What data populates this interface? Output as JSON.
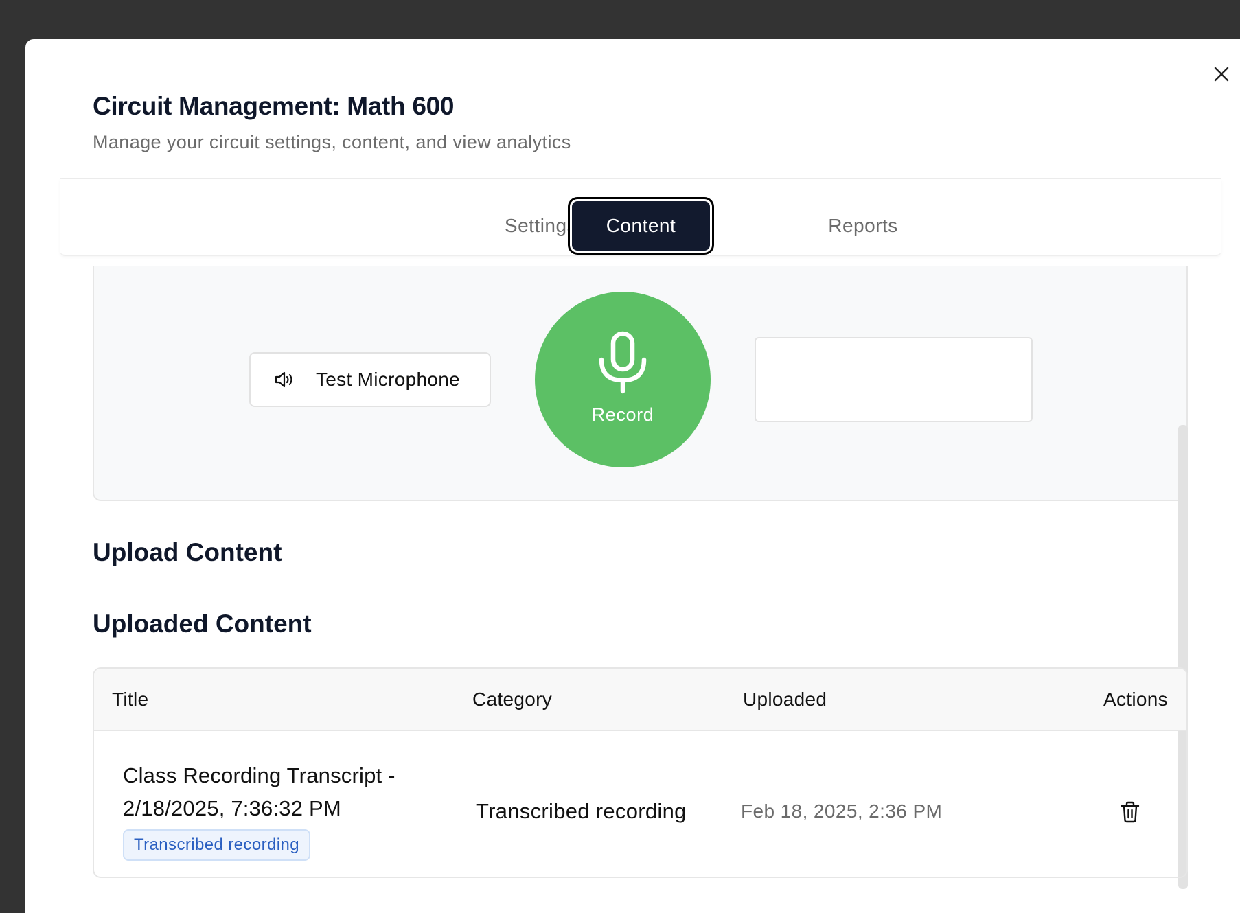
{
  "dialog": {
    "title": "Circuit Management: Math 600",
    "subtitle": "Manage your circuit settings, content, and view analytics",
    "close_icon": "close-icon"
  },
  "tabs": [
    {
      "label": "Settings",
      "active": false
    },
    {
      "label": "Content",
      "active": true
    },
    {
      "label": "Reports",
      "active": false
    }
  ],
  "recorder": {
    "test_microphone_label": "Test Microphone",
    "test_microphone_icon": "speaker-icon",
    "record_label": "Record",
    "record_icon": "microphone-icon",
    "record_color": "#5cc065",
    "status_text": ""
  },
  "upload_section": {
    "heading": "Upload Content"
  },
  "uploaded_section": {
    "heading": "Uploaded Content",
    "columns": [
      "Title",
      "Category",
      "Uploaded",
      "Actions"
    ],
    "rows": [
      {
        "title": "Class Recording Transcript - 2/18/2025, 7:36:32 PM",
        "badge": "Transcribed recording",
        "category": "Transcribed recording",
        "uploaded": "Feb 18, 2025, 2:36 PM",
        "action_icon": "trash-icon"
      }
    ]
  },
  "colors": {
    "active_tab_bg": "#121a2e",
    "badge_text": "#2a5fc1",
    "badge_bg": "#eef4fd"
  }
}
